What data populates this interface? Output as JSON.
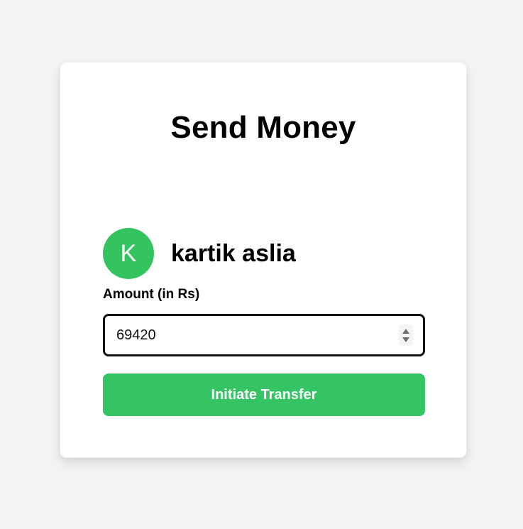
{
  "page": {
    "title": "Send Money"
  },
  "recipient": {
    "initial": "K",
    "name": "kartik aslia"
  },
  "amount": {
    "label": "Amount (in Rs)",
    "value": "69420"
  },
  "actions": {
    "transfer_label": "Initiate Transfer"
  },
  "colors": {
    "accent": "#34c463",
    "background": "#f3f4f6",
    "card": "#ffffff"
  }
}
